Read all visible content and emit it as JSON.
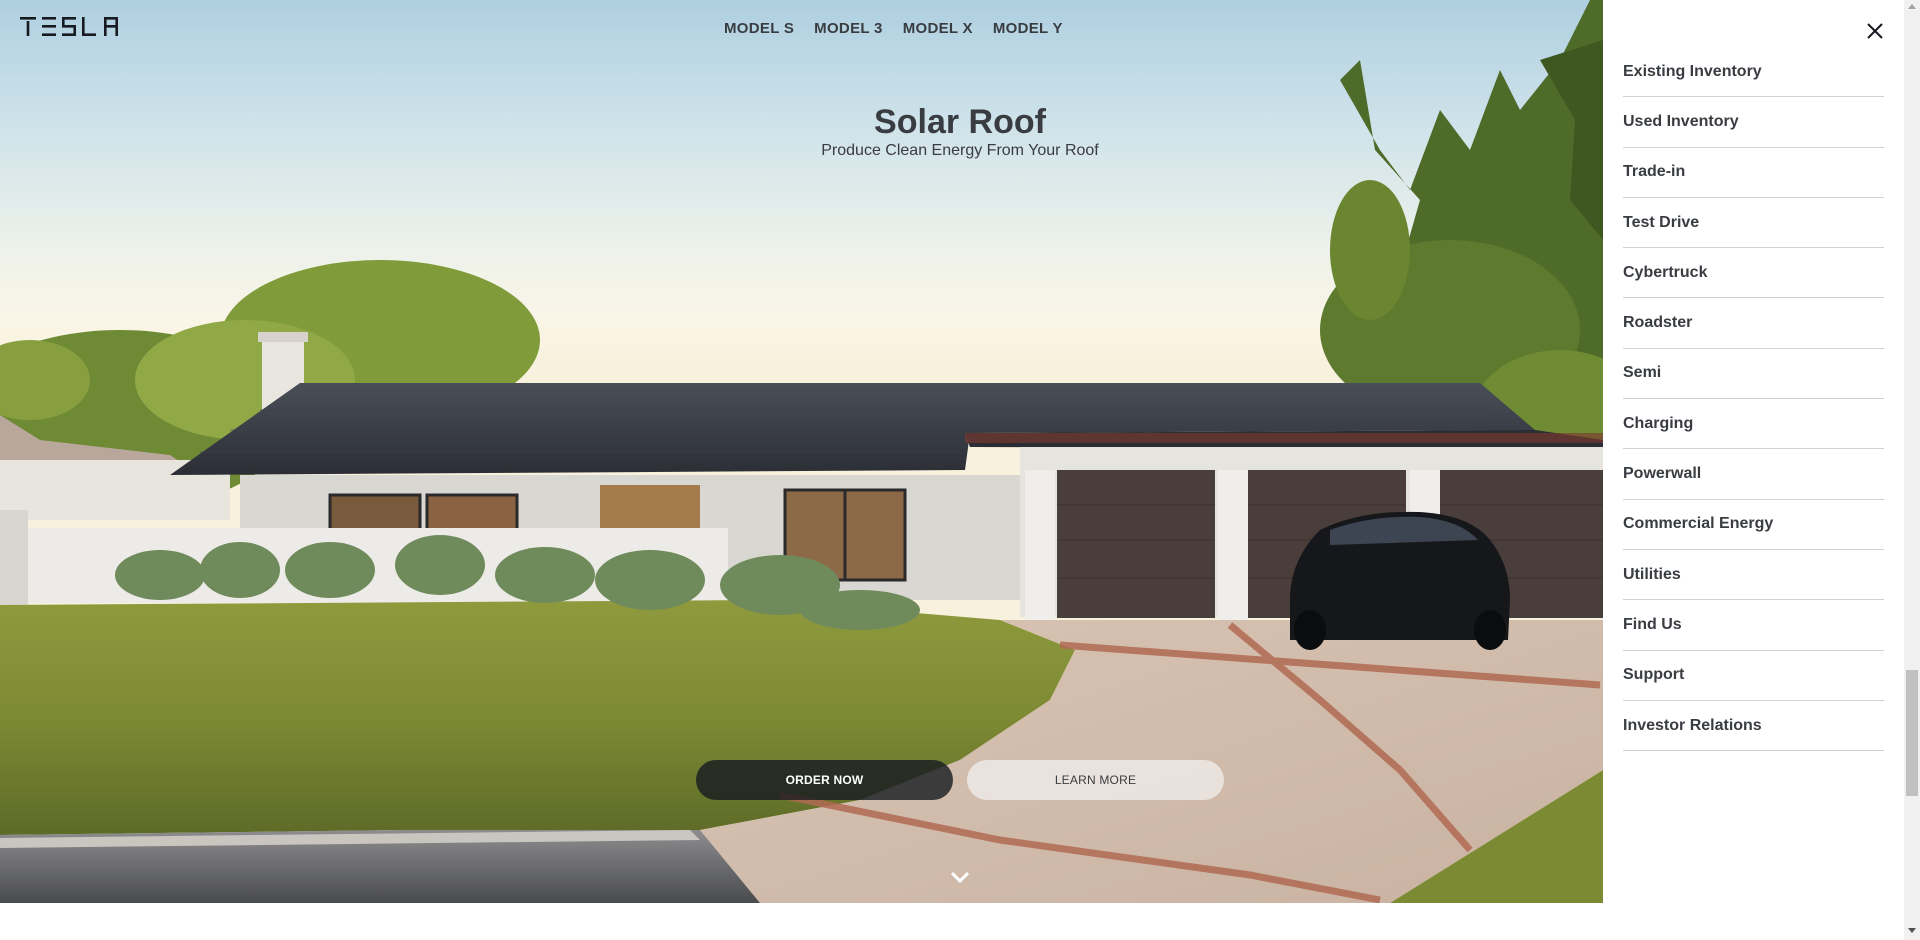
{
  "brand": {
    "logo_text": "TESLA"
  },
  "top_nav": {
    "items": [
      "MODEL S",
      "MODEL 3",
      "MODEL X",
      "MODEL Y"
    ]
  },
  "hero": {
    "title": "Solar Roof",
    "subtitle": "Produce Clean Energy From Your Roof",
    "primary_cta": "ORDER NOW",
    "secondary_cta": "LEARN MORE"
  },
  "side_menu": {
    "close_icon": "close-icon",
    "items": [
      "Existing Inventory",
      "Used Inventory",
      "Trade-in",
      "Test Drive",
      "Cybertruck",
      "Roadster",
      "Semi",
      "Charging",
      "Powerwall",
      "Commercial Energy",
      "Utilities",
      "Find Us",
      "Support",
      "Investor Relations"
    ]
  },
  "colors": {
    "text": "#393c41",
    "primary_button": "#171a20",
    "menu_background": "#ffffff",
    "divider": "#d0d1d2"
  },
  "icons": {
    "scroll_hint": "chevron-down-icon",
    "logo": "tesla-logo"
  }
}
